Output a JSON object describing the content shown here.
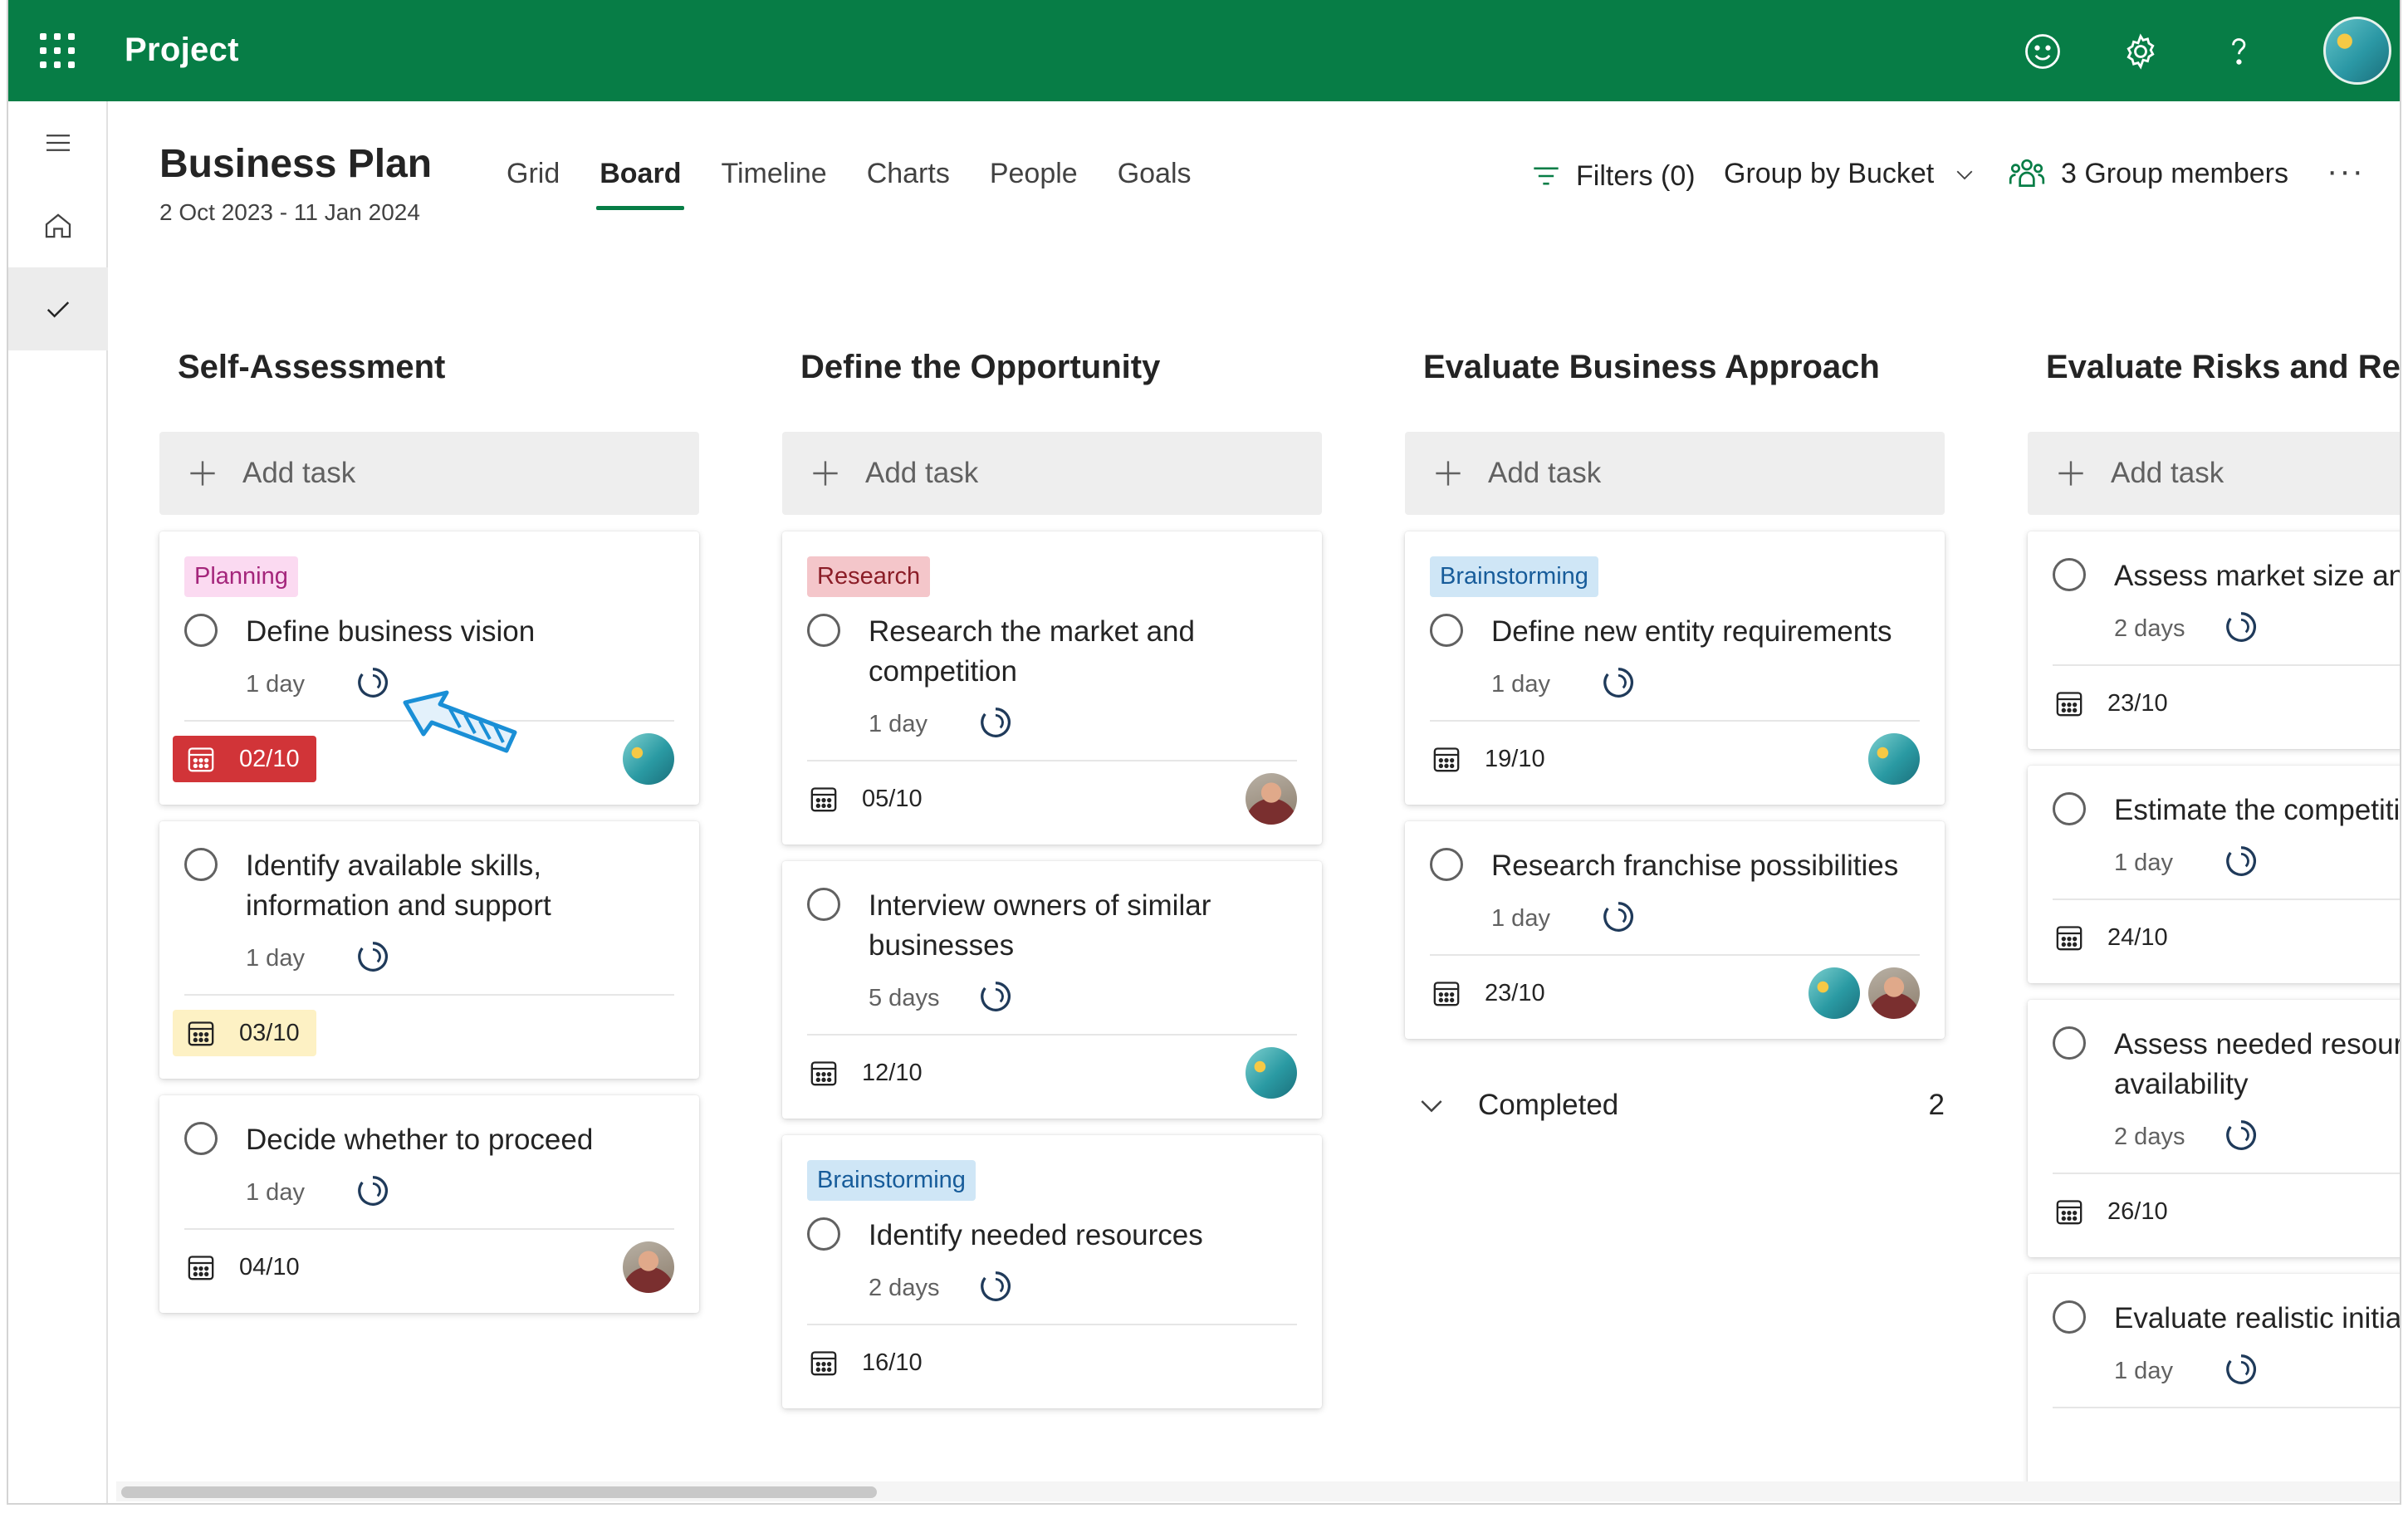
{
  "topbar": {
    "app_name": "Project",
    "brand_color": "#077d46",
    "icons": [
      "app-launcher-icon",
      "smiley-feedback-icon",
      "gear-icon",
      "help-icon"
    ]
  },
  "rail": {
    "items": [
      "menu-icon",
      "home-icon",
      "check-icon"
    ],
    "active": "check-icon"
  },
  "plan": {
    "title": "Business Plan",
    "dates": "2 Oct 2023 - 11 Jan 2024"
  },
  "tabs": [
    "Grid",
    "Board",
    "Timeline",
    "Charts",
    "People",
    "Goals"
  ],
  "active_tab": "Board",
  "toolbar": {
    "filters": "Filters (0)",
    "group_by": "Group by Bucket",
    "members": "3 Group members",
    "more": "···"
  },
  "add_task_label": "Add task",
  "buckets": [
    {
      "title": "Self-Assessment",
      "cards": [
        {
          "label": "Planning",
          "name": "Define business vision",
          "duration": "1 day",
          "due": "02/10",
          "due_status": "late",
          "assignees": [
            "teal"
          ]
        },
        {
          "name": "Identify available skills, information and support",
          "duration": "1 day",
          "due": "03/10",
          "due_status": "warn",
          "assignees": []
        },
        {
          "name": "Decide whether to proceed",
          "duration": "1 day",
          "due": "04/10",
          "assignees": [
            "man"
          ]
        }
      ]
    },
    {
      "title": "Define the Opportunity",
      "cards": [
        {
          "label": "Research",
          "name": "Research the market and competition",
          "duration": "1 day",
          "due": "05/10",
          "assignees": [
            "man"
          ]
        },
        {
          "name": "Interview owners of similar businesses",
          "duration": "5 days",
          "due": "12/10",
          "assignees": [
            "teal"
          ]
        },
        {
          "label": "Brainstorming",
          "name": "Identify needed resources",
          "duration": "2 days",
          "due": "16/10",
          "assignees": []
        }
      ]
    },
    {
      "title": "Evaluate Business Approach",
      "cards": [
        {
          "label": "Brainstorming",
          "name": "Define new entity requirements",
          "duration": "1 day",
          "due": "19/10",
          "assignees": [
            "teal"
          ]
        },
        {
          "name": "Research franchise possibilities",
          "duration": "1 day",
          "due": "23/10",
          "assignees": [
            "teal",
            "man"
          ]
        }
      ],
      "completed": {
        "label": "Completed",
        "count": "2"
      }
    },
    {
      "title": "Evaluate Risks and Rewa",
      "cards": [
        {
          "name": "Assess market size and",
          "duration": "2 days",
          "due": "23/10",
          "assignees": []
        },
        {
          "name": "Estimate the competiti",
          "duration": "1 day",
          "due": "24/10",
          "assignees": []
        },
        {
          "name": "Assess needed resourc availability",
          "duration": "2 days",
          "due": "26/10",
          "assignees": []
        },
        {
          "name": "Evaluate realistic initial share",
          "duration": "1 day",
          "due": "",
          "assignees": []
        }
      ]
    }
  ]
}
